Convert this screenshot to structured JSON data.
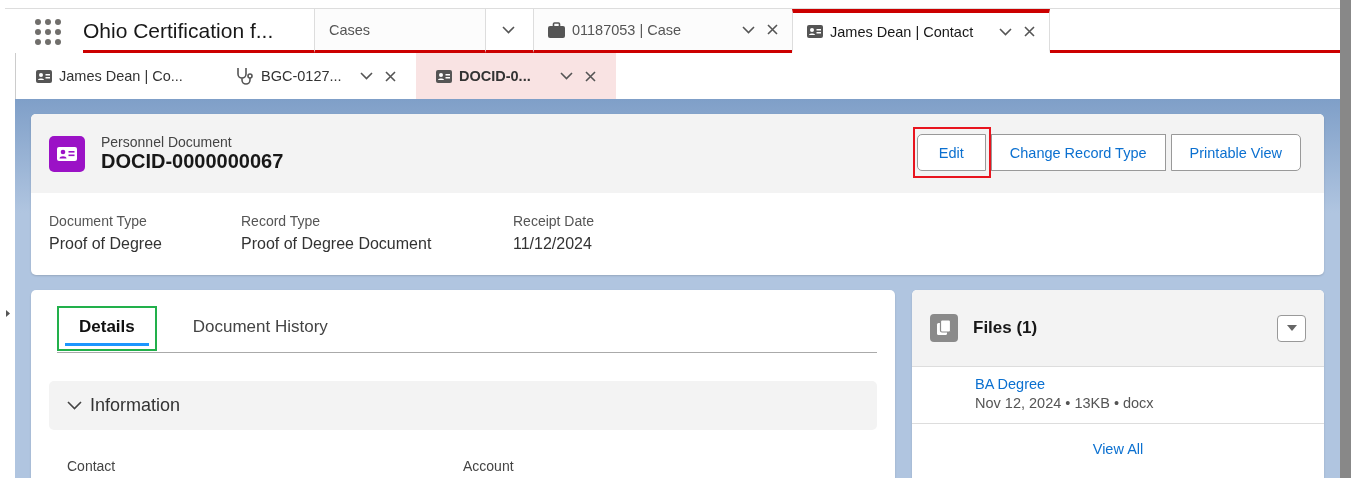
{
  "app_name": "Ohio Certification f...",
  "nav_items": [
    {
      "kind": "object",
      "label": "Cases",
      "selected": false
    },
    {
      "kind": "record",
      "label": "01187053 | Case",
      "selected": false
    },
    {
      "kind": "record",
      "label": "James Dean | Contact",
      "selected": true
    }
  ],
  "subtabs": [
    {
      "label": "James Dean | Co...",
      "closable": false,
      "selected": false
    },
    {
      "label": "BGC-0127...",
      "closable": true,
      "selected": false
    },
    {
      "label": "DOCID-0...",
      "closable": true,
      "selected": true
    }
  ],
  "record": {
    "object_label": "Personnel Document",
    "title": "DOCID-0000000067",
    "actions": [
      {
        "label": "Edit",
        "marked": true
      },
      {
        "label": "Change Record Type",
        "marked": false
      },
      {
        "label": "Printable View",
        "marked": false
      }
    ],
    "fields": [
      {
        "label": "Document Type",
        "value": "Proof of Degree"
      },
      {
        "label": "Record Type",
        "value": "Proof of Degree Document"
      },
      {
        "label": "Receipt Date",
        "value": "11/12/2024"
      }
    ]
  },
  "tabs": [
    {
      "label": "Details",
      "selected": true,
      "marked": true
    },
    {
      "label": "Document History",
      "selected": false,
      "marked": false
    }
  ],
  "section": {
    "title": "Information",
    "expanded": true,
    "field_labels": [
      "Contact",
      "Account"
    ]
  },
  "files": {
    "title": "Files (1)",
    "items": [
      {
        "name": "BA Degree",
        "meta": "Nov 12, 2024 • 13KB • docx"
      }
    ],
    "view_all": "View All"
  }
}
